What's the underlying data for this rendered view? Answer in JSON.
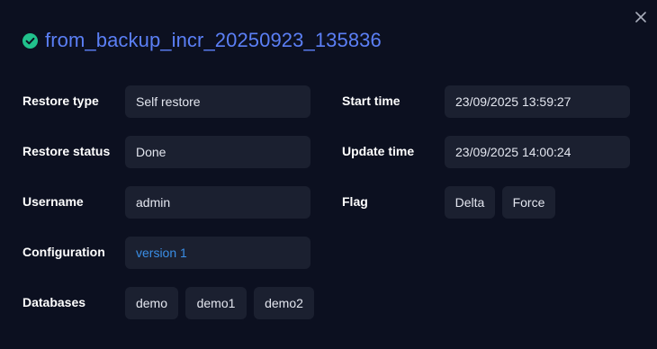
{
  "dialog": {
    "title": "from_backup_incr_20250923_135836",
    "status_icon": "check-circle-icon",
    "close_icon": "close-icon",
    "accent_color": "#5b7ff5",
    "success_color": "#21c18c"
  },
  "fields": {
    "restore_type": {
      "label": "Restore type",
      "value": "Self restore"
    },
    "restore_status": {
      "label": "Restore status",
      "value": "Done"
    },
    "username": {
      "label": "Username",
      "value": "admin"
    },
    "configuration": {
      "label": "Configuration",
      "value": "version 1"
    },
    "databases": {
      "label": "Databases",
      "items": [
        "demo",
        "demo1",
        "demo2"
      ]
    },
    "start_time": {
      "label": "Start time",
      "value": "23/09/2025 13:59:27"
    },
    "update_time": {
      "label": "Update time",
      "value": "23/09/2025 14:00:24"
    },
    "flag": {
      "label": "Flag",
      "items": [
        "Delta",
        "Force"
      ]
    }
  }
}
